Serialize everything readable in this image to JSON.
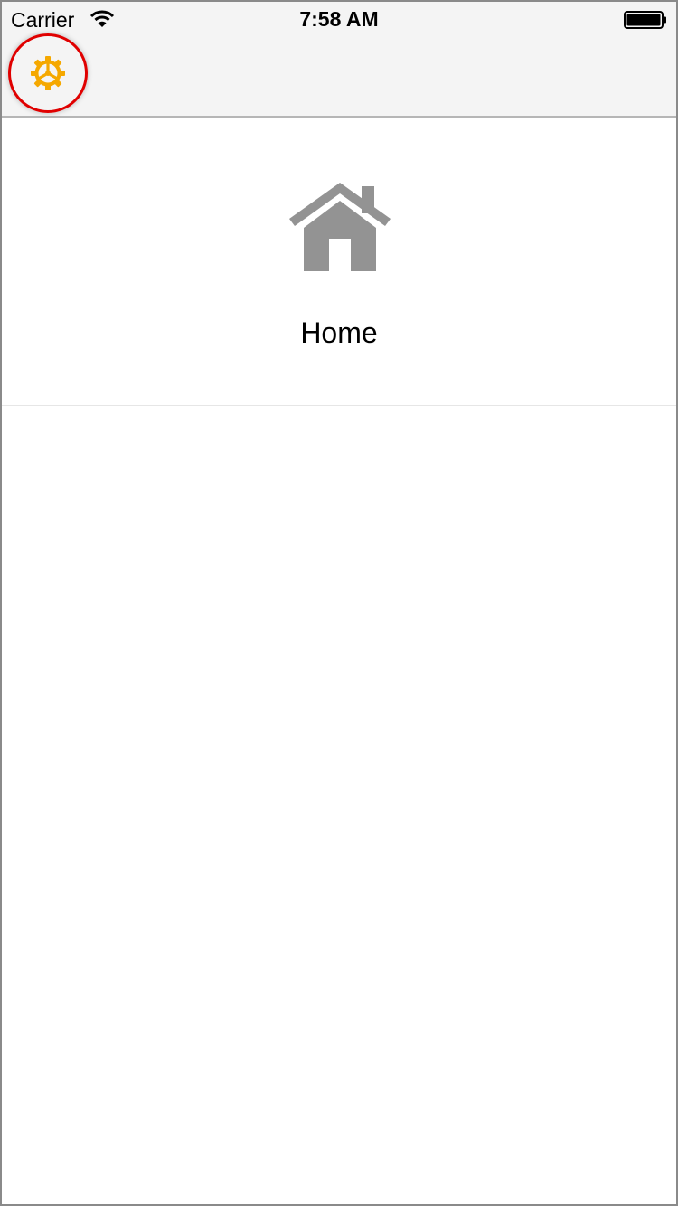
{
  "status_bar": {
    "carrier": "Carrier",
    "time": "7:58 AM",
    "wifi_icon": "wifi-icon",
    "battery_icon": "battery-icon"
  },
  "nav": {
    "settings_icon": "gear-icon",
    "settings_icon_color": "#f5a800",
    "highlight_color": "#e00000"
  },
  "home": {
    "icon": "house-icon",
    "icon_color": "#939393",
    "label": "Home"
  }
}
